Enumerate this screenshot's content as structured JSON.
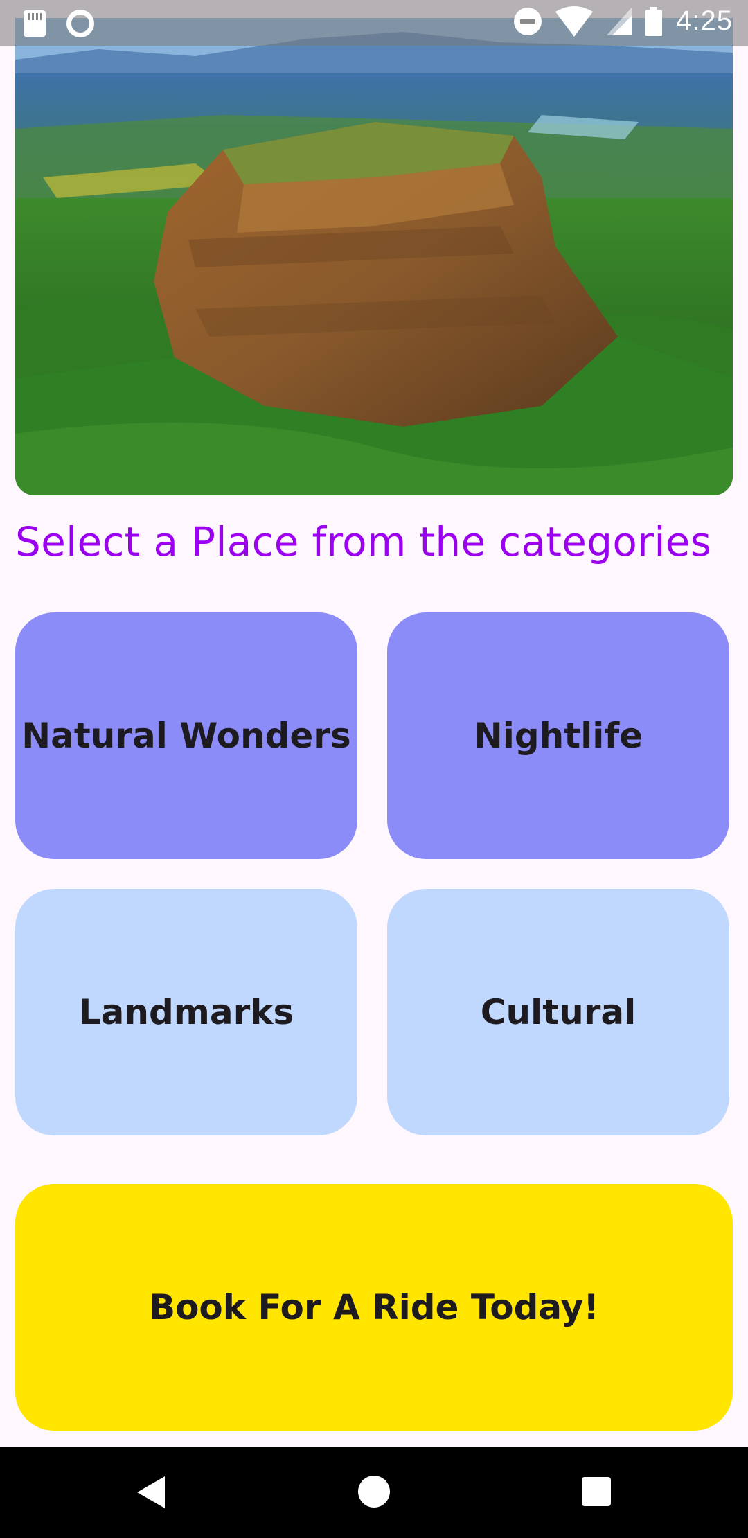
{
  "status_bar": {
    "time": "4:25",
    "icons": [
      "sd-card-icon",
      "ring-icon",
      "do-not-disturb-icon",
      "wifi-icon",
      "signal-icon",
      "battery-icon"
    ]
  },
  "hero_image": {
    "subject": "sigiriya-rock-fortress"
  },
  "heading": "Select a Place from the categories",
  "categories": [
    {
      "label": "Natural Wonders",
      "color": "#8c8cf8"
    },
    {
      "label": "Nightlife",
      "color": "#8c8cf8"
    },
    {
      "label": "Landmarks",
      "color": "#c0d8fd"
    },
    {
      "label": "Cultural",
      "color": "#c0d8fd"
    }
  ],
  "cta": {
    "label": "Book For A Ride Today!",
    "color": "#ffe500"
  },
  "colors": {
    "background": "#fef7fd",
    "heading": "#9b00f0",
    "tile_primary": "#8c8cf8",
    "tile_secondary": "#c0d8fd",
    "cta": "#ffe500",
    "nav_bar": "#000000"
  },
  "nav_bar": {
    "buttons": [
      "back-icon",
      "home-icon",
      "recents-icon"
    ]
  }
}
